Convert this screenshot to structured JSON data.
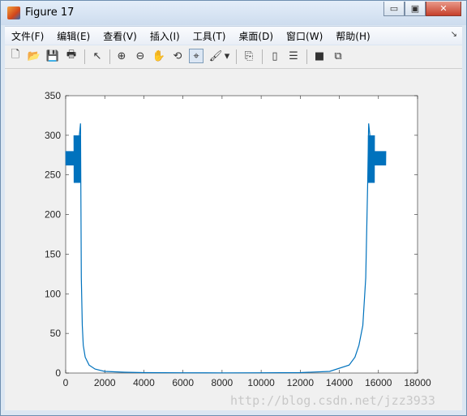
{
  "window": {
    "title": "Figure 17",
    "controls": {
      "minimize": "▭",
      "maximize": "▣",
      "close": "✕"
    }
  },
  "menubar": {
    "items": [
      "文件(F)",
      "编辑(E)",
      "查看(V)",
      "插入(I)",
      "工具(T)",
      "桌面(D)",
      "窗口(W)",
      "帮助(H)"
    ],
    "overflow": "↘"
  },
  "toolbar": {
    "buttons": [
      {
        "name": "new-figure-icon",
        "glyph": "🗋"
      },
      {
        "name": "open-file-icon",
        "glyph": "📂"
      },
      {
        "name": "save-icon",
        "glyph": "💾"
      },
      {
        "name": "print-icon",
        "glyph": "🖶"
      },
      {
        "name": "pointer-icon",
        "glyph": "↖"
      },
      {
        "name": "zoom-in-icon",
        "glyph": "⊕"
      },
      {
        "name": "zoom-out-icon",
        "glyph": "⊖"
      },
      {
        "name": "pan-icon",
        "glyph": "✋"
      },
      {
        "name": "rotate-3d-icon",
        "glyph": "⟲"
      },
      {
        "name": "data-cursor-icon",
        "glyph": "⌖"
      },
      {
        "name": "brush-icon",
        "glyph": "🖌"
      },
      {
        "name": "brush-dropdown-icon",
        "glyph": "▾"
      },
      {
        "name": "link-plot-icon",
        "glyph": "⎘"
      },
      {
        "name": "colorbar-icon",
        "glyph": "▯"
      },
      {
        "name": "legend-icon",
        "glyph": "☰"
      },
      {
        "name": "hide-plot-tools-icon",
        "glyph": "■"
      },
      {
        "name": "show-plot-tools-icon",
        "glyph": "⧉"
      }
    ]
  },
  "watermark": "http://blog.csdn.net/jzz3933",
  "colors": {
    "line": "#0072bd",
    "axes": "#262626",
    "figure_bg": "#f0f0f0"
  },
  "chart_data": {
    "type": "line",
    "title": "",
    "xlabel": "",
    "ylabel": "",
    "xlim": [
      0,
      18000
    ],
    "ylim": [
      0,
      350
    ],
    "xticks": [
      0,
      2000,
      4000,
      6000,
      8000,
      10000,
      12000,
      14000,
      16000,
      18000
    ],
    "yticks": [
      0,
      50,
      100,
      150,
      200,
      250,
      300,
      350
    ],
    "grid": false,
    "series": [
      {
        "x": [
          0,
          400,
          600,
          700,
          760,
          800,
          850,
          900,
          1000,
          1200,
          1500,
          2000,
          3000,
          4000,
          6000,
          8000,
          10000,
          12000,
          13500,
          14500,
          14800,
          15000,
          15200,
          15350,
          15450,
          15500,
          15560,
          15600,
          15700,
          16000,
          16384
        ],
        "y": [
          270,
          270,
          275,
          300,
          315,
          120,
          60,
          35,
          20,
          10,
          5,
          2,
          1,
          0.5,
          0.3,
          0.2,
          0.3,
          0.5,
          2,
          10,
          20,
          35,
          60,
          120,
          240,
          315,
          300,
          280,
          270,
          270,
          270
        ]
      }
    ]
  }
}
